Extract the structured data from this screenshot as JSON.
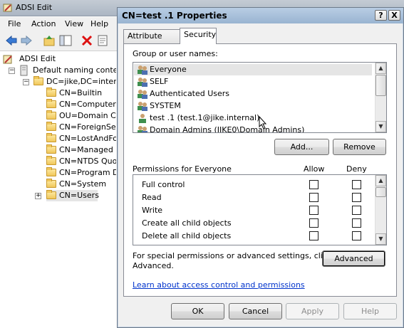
{
  "adsi": {
    "title": "ADSI Edit",
    "menu": [
      "File",
      "Action",
      "View",
      "Help"
    ],
    "tree": {
      "root": "ADSI Edit",
      "naming_context": "Default naming context",
      "domain": "DC=jike,DC=interna",
      "containers": [
        "CN=Builtin",
        "CN=Computers",
        "OU=Domain Cor",
        "CN=ForeignSecu",
        "CN=LostAndFou",
        "CN=Managed Se",
        "CN=NTDS Quota",
        "CN=Program Da",
        "CN=System",
        "CN=Users"
      ]
    }
  },
  "dialog": {
    "title": "CN=test .1 Properties",
    "help_button": "?",
    "close_button": "X",
    "tabs": [
      "Attribute Editor",
      "Security"
    ],
    "active_tab": "Security",
    "group_label": "Group or user names:",
    "users": [
      "Everyone",
      "SELF",
      "Authenticated Users",
      "SYSTEM",
      "test .1 (test.1@jike.internal)",
      "Domain Admins (JIKE0\\Domain Admins)"
    ],
    "add_button": "Add...",
    "remove_button": "Remove",
    "permissions_label": "Permissions for Everyone",
    "allow_header": "Allow",
    "deny_header": "Deny",
    "permissions": [
      "Full control",
      "Read",
      "Write",
      "Create all child objects",
      "Delete all child objects"
    ],
    "special_text_line1": "For special permissions or advanced settings, click",
    "special_text_line2": "Advanced.",
    "advanced_button": "Advanced",
    "learn_link": "Learn about access control and permissions",
    "ok_button": "OK",
    "cancel_button": "Cancel",
    "apply_button": "Apply",
    "help_footer_button": "Help"
  },
  "colors": {
    "dialog_title_bg": "#99b4d1",
    "link": "#0033cc",
    "selection": "#e5e5e5"
  }
}
